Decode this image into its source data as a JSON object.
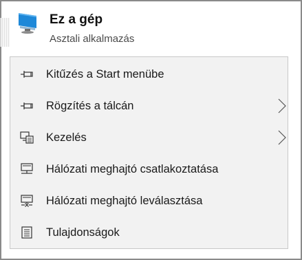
{
  "header": {
    "title": "Ez a gép",
    "subtitle": "Asztali alkalmazás",
    "icon": "computer-monitor-icon"
  },
  "menu": {
    "items": [
      {
        "label": "Kitűzés a Start menübe",
        "icon": "pin-icon"
      },
      {
        "label": "Rögzítés a tálcán",
        "icon": "pin-icon"
      },
      {
        "label": "Kezelés",
        "icon": "computer-management-icon"
      },
      {
        "label": "Hálózati meghajtó csatlakoztatása",
        "icon": "map-network-drive-icon"
      },
      {
        "label": "Hálózati meghajtó leválasztása",
        "icon": "disconnect-network-drive-icon"
      },
      {
        "label": "Tulajdonságok",
        "icon": "properties-icon"
      }
    ]
  },
  "colors": {
    "menu_background": "#f2f2f2",
    "menu_border": "#c8c8c8",
    "frame_border": "#8a8a8a",
    "monitor_blue": "#1e88d8"
  }
}
